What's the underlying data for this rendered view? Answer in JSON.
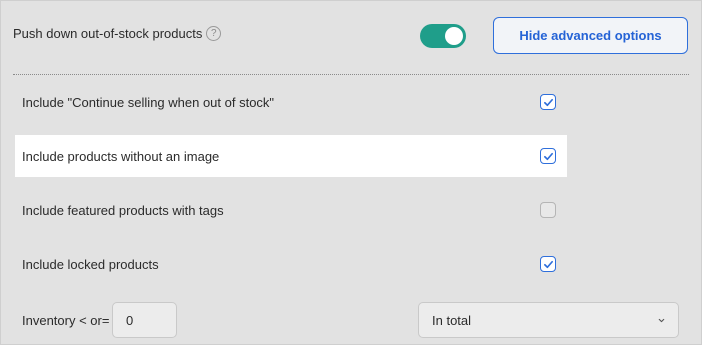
{
  "header": {
    "label": "Push down out-of-stock products",
    "help_icon": "?",
    "toggle_on": true,
    "advanced_button_label": "Hide advanced options"
  },
  "options": [
    {
      "label": "Include \"Continue selling when out of stock\"",
      "checked": true
    },
    {
      "label": "Include products without an image",
      "checked": true
    },
    {
      "label": "Include featured products with tags",
      "checked": false
    },
    {
      "label": "Include locked products",
      "checked": true
    }
  ],
  "inventory": {
    "label": "Inventory < or=",
    "value": "0",
    "select_value": "In total"
  },
  "colors": {
    "accent": "#2563d6",
    "toggle": "#1f9e8a",
    "background": "#e2e2e2"
  }
}
